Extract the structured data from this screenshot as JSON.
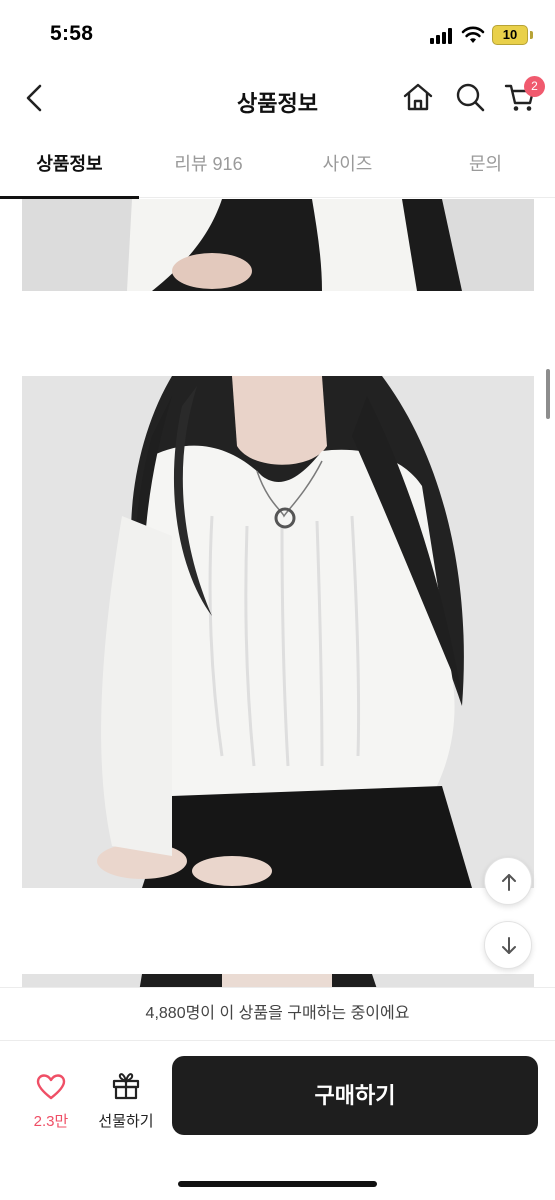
{
  "status_bar": {
    "time": "5:58",
    "battery": "10",
    "icons": [
      "cellular-signal-icon",
      "wifi-icon",
      "battery-icon"
    ]
  },
  "header": {
    "title": "상품정보",
    "cart_badge": "2",
    "icons": [
      "back-arrow-icon",
      "home-icon",
      "search-icon",
      "cart-icon"
    ]
  },
  "tabs": [
    {
      "label": "상품정보",
      "active": true
    },
    {
      "label": "리뷰 916",
      "active": false
    },
    {
      "label": "사이즈",
      "active": false
    },
    {
      "label": "문의",
      "active": false
    }
  ],
  "content": {
    "images": [
      "product-photo-top-partial",
      "product-photo-white-knit-sweater",
      "product-photo-bottom-partial"
    ],
    "float_buttons": [
      "scroll-up-icon",
      "scroll-down-icon"
    ]
  },
  "buyer_notice": "4,880명이 이 상품을 구매하는 중이에요",
  "bottom_bar": {
    "like_count": "2.3만",
    "gift_label": "선물하기",
    "buy_label": "구매하기"
  },
  "colors": {
    "accent_pink": "#ef4f66",
    "badge": "#f05a6e",
    "buy_button": "#1e1e1e",
    "battery": "#e9d04a"
  }
}
